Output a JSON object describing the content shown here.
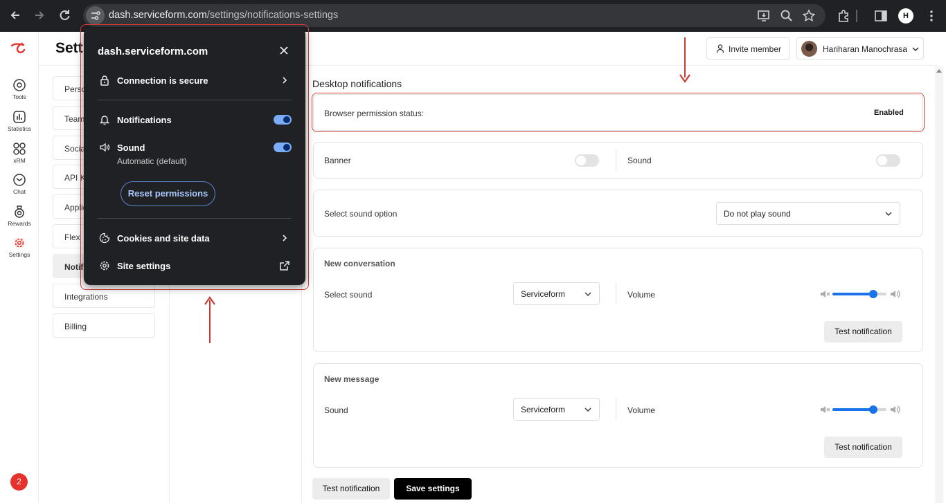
{
  "browser": {
    "url_domain": "dash.serviceform.com",
    "url_path": "/settings/notifications-settings"
  },
  "rail": {
    "items": [
      {
        "label": "Tools"
      },
      {
        "label": "Statistics"
      },
      {
        "label": "xRM"
      },
      {
        "label": "Chat"
      },
      {
        "label": "Rewards"
      },
      {
        "label": "Settings"
      }
    ],
    "notification_count": "2",
    "accent_color": "#e5322d"
  },
  "header": {
    "title": "Settings",
    "invite_label": "Invite member",
    "user_name": "Hariharan Manochrasa"
  },
  "subnav": {
    "items": [
      {
        "label": "Personal"
      },
      {
        "label": "Team"
      },
      {
        "label": "Social"
      },
      {
        "label": "API Keys"
      },
      {
        "label": "Applications"
      },
      {
        "label": "Flex"
      },
      {
        "label": "Notifications"
      },
      {
        "label": "Integrations"
      },
      {
        "label": "Billing"
      }
    ]
  },
  "main": {
    "section_title": "Desktop notifications",
    "permission_label": "Browser permission status:",
    "permission_value": "Enabled",
    "banner_label": "Banner",
    "banner_sound_label": "Sound",
    "sound_option_label": "Select sound option",
    "sound_option_value": "Do not play sound",
    "new_conversation": {
      "title": "New conversation",
      "sound_label": "Select sound",
      "sound_value": "Serviceform",
      "volume_label": "Volume",
      "volume_level": 0.75,
      "test_label": "Test notification"
    },
    "new_message": {
      "title": "New message",
      "sound_label": "Sound",
      "sound_value": "Serviceform",
      "volume_label": "Volume",
      "volume_level": 0.75,
      "test_label": "Test notification"
    },
    "footer_test_label": "Test notification",
    "save_label": "Save settings"
  },
  "popup": {
    "domain": "dash.serviceform.com",
    "connection_label": "Connection is secure",
    "notifications_label": "Notifications",
    "notifications_on": true,
    "sound_label": "Sound",
    "sound_sub": "Automatic (default)",
    "sound_on": true,
    "reset_label": "Reset permissions",
    "cookies_label": "Cookies and site data",
    "site_settings_label": "Site settings"
  }
}
